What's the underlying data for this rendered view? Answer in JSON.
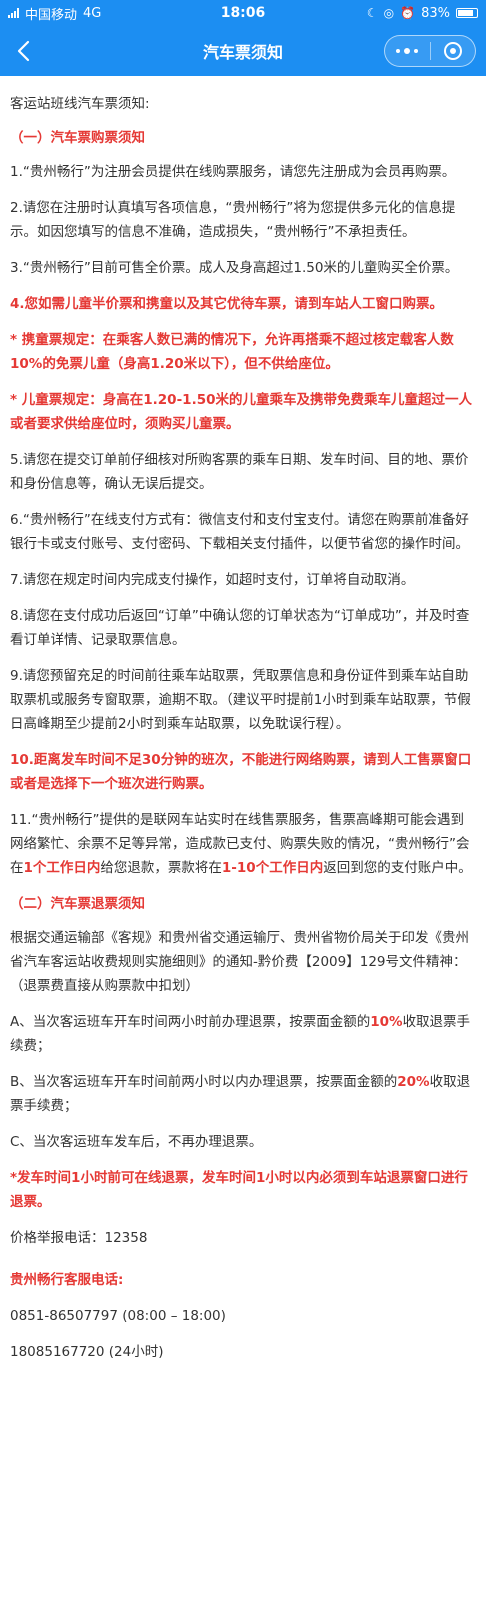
{
  "status_bar": {
    "carrier": "中国移动",
    "network": "4G",
    "time": "18:06",
    "battery": "83%",
    "battery_level": 0.83
  },
  "nav": {
    "title": "汽车票须知",
    "back_icon": "chevron-left-icon",
    "more_icon": "more-dots-icon",
    "close_icon": "target-circle-icon"
  },
  "colors": {
    "accent": "#1c8ef2",
    "emphasis": "#e53935"
  },
  "content": {
    "intro": "客运站班线汽车票须知:",
    "section1_title": "（一）汽车票购票须知",
    "item1": "1.“贵州畅行”为注册会员提供在线购票服务，请您先注册成为会员再购票。",
    "item2": "2.请您在注册时认真填写各项信息，“贵州畅行”将为您提供多元化的信息提示。如因您填写的信息不准确，造成损失，“贵州畅行”不承担责任。",
    "item3": "3.“贵州畅行”目前可售全价票。成人及身高超过1.50米的儿童购买全价票。",
    "item4": "4.您如需儿童半价票和携童以及其它优待车票，请到车站人工窗口购票。",
    "carry_child": "* 携童票规定：在乘客人数已满的情况下，允许再搭乘不超过核定载客人数10%的免票儿童（身高1.20米以下），但不供给座位。",
    "child_ticket": "* 儿童票规定：身高在1.20-1.50米的儿童乘车及携带免费乘车儿童超过一人或者要求供给座位时，须购买儿童票。",
    "item5": "5.请您在提交订单前仔细核对所购客票的乘车日期、发车时间、目的地、票价和身份信息等，确认无误后提交。",
    "item6": "6.“贵州畅行”在线支付方式有：微信支付和支付宝支付。请您在购票前准备好银行卡或支付账号、支付密码、下载相关支付插件，以便节省您的操作时间。",
    "item7": "7.请您在规定时间内完成支付操作，如超时支付，订单将自动取消。",
    "item8": "8.请您在支付成功后返回“订单”中确认您的订单状态为“订单成功”，并及时查看订单详情、记录取票信息。",
    "item9": "9.请您预留充足的时间前往乘车站取票，凭取票信息和身份证件到乘车站自助取票机或服务专窗取票，逾期不取。（建议平时提前1小时到乘车站取票，节假日高峰期至少提前2小时到乘车站取票，以免耽误行程）。",
    "item10": "10.距离发车时间不足30分钟的班次，不能进行网络购票，请到人工售票窗口或者是选择下一个班次进行购票。",
    "item11_a": "11.“贵州畅行”提供的是联网车站实时在线售票服务，售票高峰期可能会遇到网络繁忙、余票不足等异常，造成款已支付、购票失败的情况，“贵州畅行”会在",
    "item11_b": "1个工作日内",
    "item11_c": "给您退款，票款将在",
    "item11_d": "1-10个工作日内",
    "item11_e": "返回到您的支付账户中。",
    "section2_title": "（二）汽车票退票须知",
    "refund_basis": "根据交通运输部《客规》和贵州省交通运输厅、贵州省物价局关于印发《贵州省汽车客运站收费规则实施细则》的通知-黔价费【2009】129号文件精神：（退票费直接从购票款中扣划）",
    "rule_a_pre": "A、当次客运班车开车时间两小时前办理退票，按票面金额的",
    "rule_a_pct": "10%",
    "rule_a_post": "收取退票手续费；",
    "rule_b_pre": "B、当次客运班车开车时间前两小时以内办理退票，按票面金额的",
    "rule_b_pct": "20%",
    "rule_b_post": "收取退票手续费；",
    "rule_c": "C、当次客运班车发车后，不再办理退票。",
    "refund_note": "*发车时间1小时前可在线退票，发车时间1小时以内必须到车站退票窗口进行退票。",
    "price_hotline": "价格举报电话：12358",
    "service_title": "贵州畅行客服电话:",
    "phone1": "0851-86507797 (08:00 – 18:00)",
    "phone2": "18085167720 (24小时)"
  }
}
